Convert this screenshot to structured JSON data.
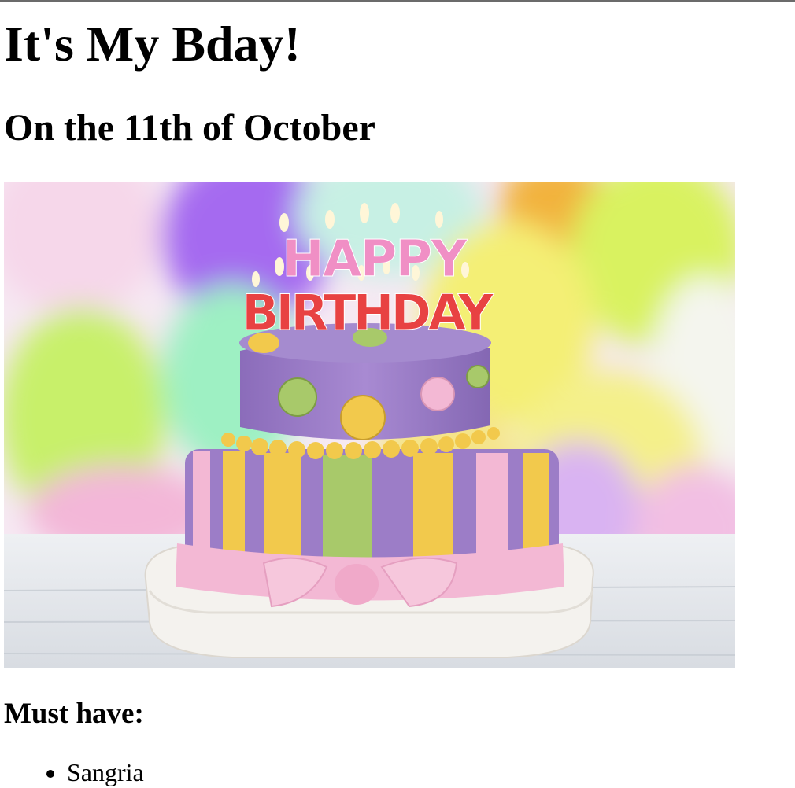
{
  "page": {
    "title": "It's My Bday!",
    "subtitle": "On the 11th of October",
    "section_heading": "Must have:",
    "list_items": [
      "Sangria"
    ]
  },
  "image": {
    "candle_text_top": "HAPPY",
    "candle_text_bottom": "BIRTHDAY",
    "colors": {
      "balloon_purple": "#a56bf0",
      "balloon_yellow": "#f3f07a",
      "balloon_green": "#c9f26a",
      "cake_purple": "#9c7dc7",
      "ribbon_pink": "#f3b8d4",
      "stripe_yellow": "#f2c94c",
      "stripe_green": "#a8c96a"
    }
  }
}
